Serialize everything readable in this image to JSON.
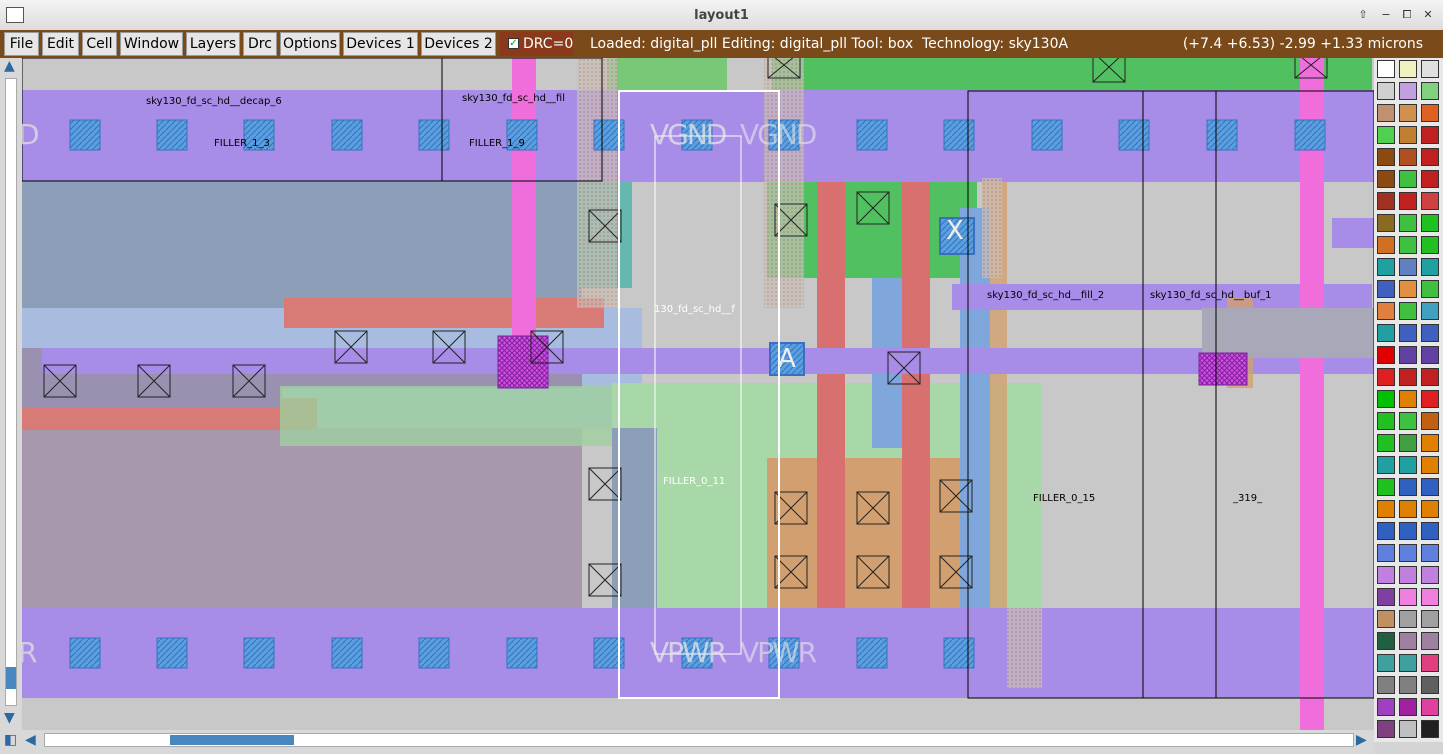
{
  "window": {
    "title": "layout1",
    "controls": [
      "⇧",
      "−",
      "⧠",
      "✕"
    ]
  },
  "menu": {
    "items": [
      "File",
      "Edit",
      "Cell",
      "Window",
      "Layers",
      "Drc",
      "Options",
      "Devices 1",
      "Devices 2"
    ]
  },
  "drc": {
    "label": "DRC=0",
    "checked": true
  },
  "status": {
    "text": "Loaded: digital_pll Editing: digital_pll Tool: box  Technology: sky130A",
    "coords": "(+7.4 +6.53) -2.99 +1.33 microns"
  },
  "cells": [
    {
      "name": "sky130_fd_sc_hd__decap_6"
    },
    {
      "name": "FILLER_1_3"
    },
    {
      "name": "sky130_fd_sc_hd__fil"
    },
    {
      "name": "FILLER_1_9"
    },
    {
      "name": "130_fd_sc_hd__f"
    },
    {
      "name": "FILLER_0_11"
    },
    {
      "name": "sky130_fd_sc_hd__fill_2"
    },
    {
      "name": "FILLER_0_15"
    },
    {
      "name": "sky130_fd_sc_hd__buf_1"
    },
    {
      "name": "_319_"
    }
  ],
  "pins": {
    "left_top": "D",
    "left_bottom": "R",
    "vgnd": "VGND",
    "vpwr": "VPWR",
    "a": "A",
    "x": "X"
  },
  "colors": {
    "metal1": "#a78ce8",
    "poly": "#e0707a",
    "diff": "#8fd08f",
    "nwell": "#9a8fb0",
    "li": "#7fa7dc",
    "contact": "#4f8fd8",
    "pink": "#f06edc",
    "brown_bar": "#7a4a1a",
    "drc_bg": "#8a3a1a",
    "selection": "#ffffff"
  },
  "palette": {
    "swatches": [
      "#ffffff",
      "#f0f0c0",
      "#e0e0e0",
      "#d0d0d0",
      "#c0a0e0",
      "#80d080",
      "#c09070",
      "#d09050",
      "#e06020",
      "#50d050",
      "#c08030",
      "#c02020",
      "#8a4a10",
      "#b05020",
      "#c02020",
      "#8a4a10",
      "#40c040",
      "#c02020",
      "#a03020",
      "#c02020",
      "#d04040",
      "#8a6a20",
      "#40c040",
      "#20c020",
      "#d07020",
      "#40c040",
      "#20c020",
      "#20a0a0",
      "#6080c0",
      "#20a0a0",
      "#4060c0",
      "#e09040",
      "#40c040",
      "#e08040",
      "#40c040",
      "#40a0c0",
      "#20a0a0",
      "#4060c0",
      "#4060c0",
      "#e00000",
      "#6040a0",
      "#6040a0",
      "#e02020",
      "#c02020",
      "#c02020",
      "#00c000",
      "#e08000",
      "#e02020",
      "#20c020",
      "#40c040",
      "#c06010",
      "#20c020",
      "#40a040",
      "#e08000",
      "#20a0a0",
      "#20a0a0",
      "#e08000",
      "#20c020",
      "#3060c0",
      "#3060c0",
      "#e08000",
      "#e08000",
      "#e08000",
      "#3060c0",
      "#3060c0",
      "#3060c0",
      "#6080e0",
      "#6080e0",
      "#6080e0",
      "#c080e0",
      "#c080e0",
      "#c080e0",
      "#8040a0",
      "#f080e0",
      "#f080e0",
      "#c09060",
      "#a0a0a0",
      "#a0a0a0",
      "#206040",
      "#a080a0",
      "#a080a0",
      "#40a0a0",
      "#40a0a0",
      "#e04080",
      "#808080",
      "#808080",
      "#606060",
      "#a040c0",
      "#a020a0",
      "#e040a0",
      "#804080",
      "#c0c0c0",
      "#202020"
    ]
  },
  "scroll": {
    "h_position": 0.1,
    "v_position": 0.95
  }
}
